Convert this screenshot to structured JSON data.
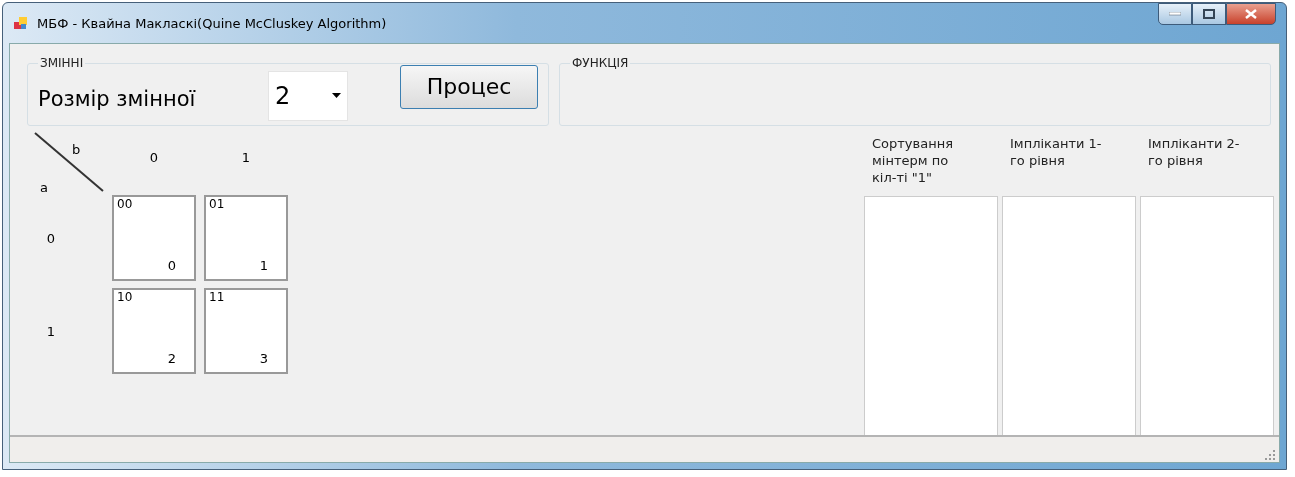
{
  "window": {
    "title": "МБФ - Квайна Макласкі(Quine McCluskey Algorithm)"
  },
  "variables_group": {
    "title": "ЗМІННІ",
    "label": "Розмір змінної",
    "size_select": {
      "value": "2"
    },
    "process_button": "Процес"
  },
  "function_group": {
    "title": "ФУНКЦІЯ"
  },
  "kmap": {
    "col_var": "b",
    "row_var": "a",
    "col_headers": [
      "0",
      "1"
    ],
    "rows": [
      {
        "header": "0",
        "cells": [
          {
            "code": "00",
            "index": "0"
          },
          {
            "code": "01",
            "index": "1"
          }
        ]
      },
      {
        "header": "1",
        "cells": [
          {
            "code": "10",
            "index": "2"
          },
          {
            "code": "11",
            "index": "3"
          }
        ]
      }
    ]
  },
  "lists": [
    {
      "header": "Сортування мінтерм по кіл-ті \"1\""
    },
    {
      "header": "Імпліканти 1-го рівня"
    },
    {
      "header": "Імпліканти 2-го рівня"
    }
  ]
}
